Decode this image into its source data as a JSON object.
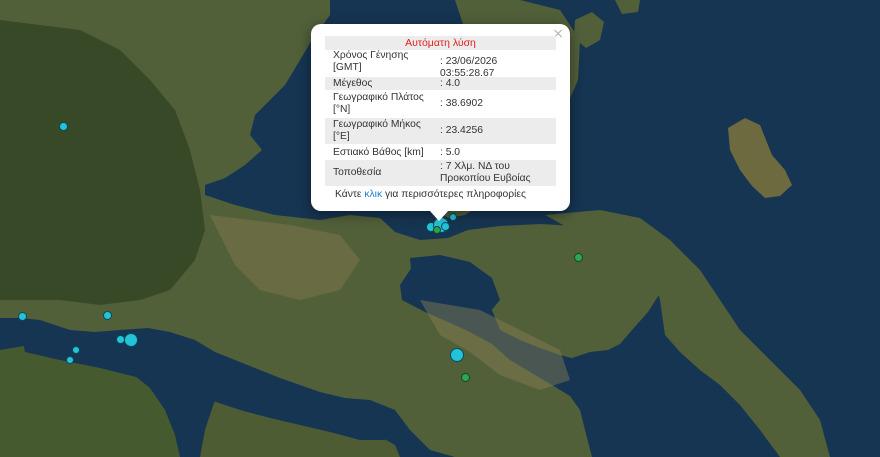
{
  "popup": {
    "title": "Αυτόματη λύση",
    "close_glyph": "×",
    "rows": [
      {
        "label": "Χρόνος Γένησης [GMT]",
        "value": ": 23/06/2026 03:55:28.67"
      },
      {
        "label": "Μέγεθος",
        "value": ": 4.0"
      },
      {
        "label": "Γεωγραφικό Πλάτος [°N]",
        "value": ": 38.6902"
      },
      {
        "label": "Γεωγραφικό Μήκος [°E]",
        "value": ": 23.4256"
      },
      {
        "label": "Εστιακό Βάθος [km]",
        "value": ": 5.0"
      },
      {
        "label": "Τοποθεσία",
        "value": ": 7 Χλμ. ΝΔ του Προκοπίου Ευβοίας"
      }
    ],
    "footer_before": "Κάντε ",
    "footer_link": "κλικ",
    "footer_after": " για περισσότερες πληροφορίες"
  },
  "colors": {
    "sea": "#163552",
    "land": "#51603a",
    "marker_cyan": "#23c4d9",
    "marker_green": "#2fa35a",
    "popup_title": "#e0201b",
    "link": "#1a7fd0"
  }
}
